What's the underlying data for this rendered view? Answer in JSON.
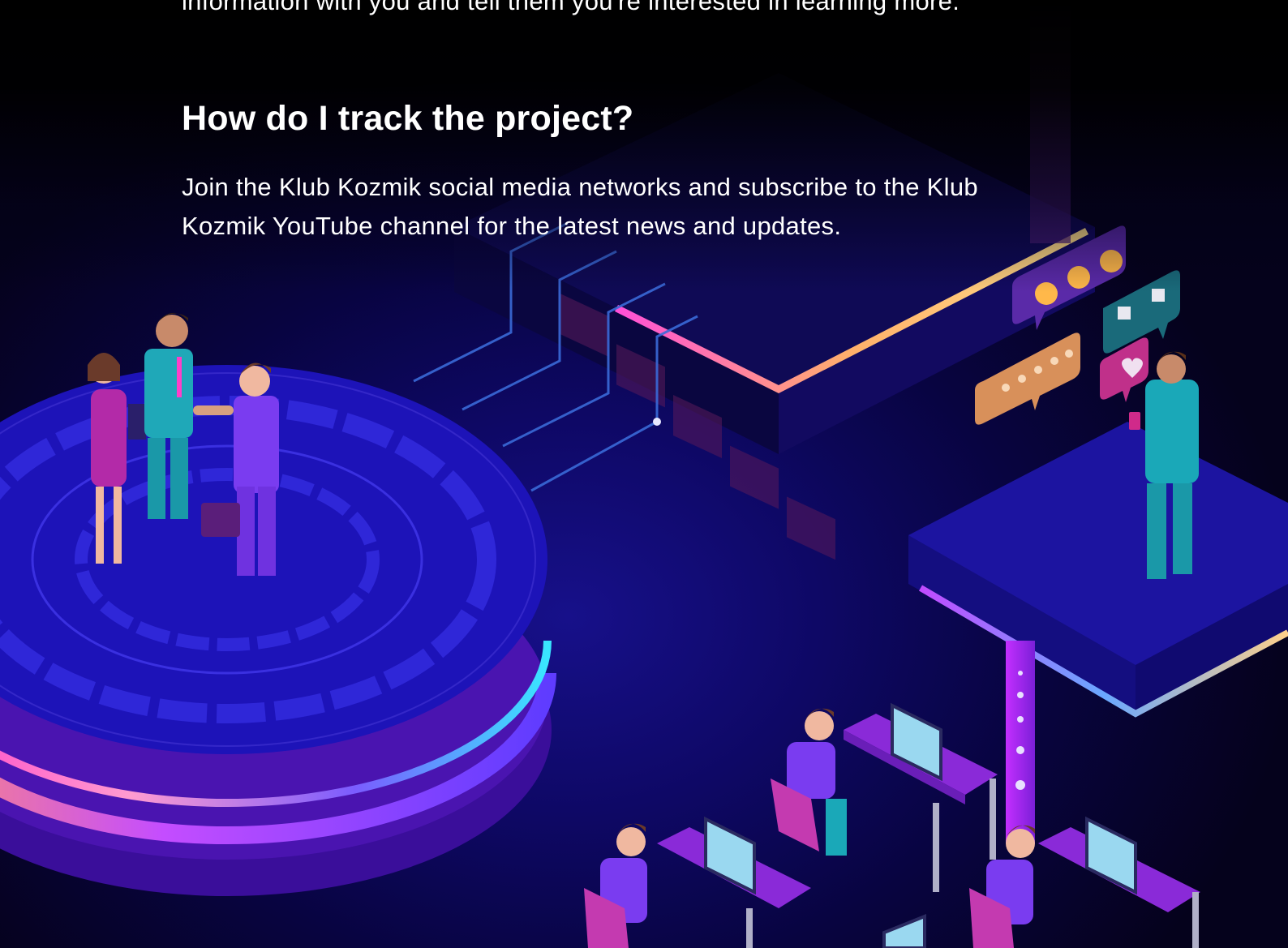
{
  "section": {
    "intro_tail": "information with you and tell them you're interested in learning more.",
    "heading": "How do I track the project?",
    "body": "Join the Klub Kozmik social media networks and subscribe to the Klub Kozmik YouTube channel for the latest news and updates."
  },
  "illustration": {
    "icons": [
      "handshake-scene",
      "circular-platform",
      "circuit-lines",
      "feedback-bubbles",
      "thumbs-up-down-icon",
      "heart-icon",
      "star-rating-icon",
      "emoji-faces-icon",
      "office-desks-scene",
      "laptop-icon"
    ],
    "colors": {
      "background": "#0e0865",
      "accent_magenta": "#ff3ec8",
      "accent_cyan": "#39e6ff",
      "accent_orange": "#ffb06a",
      "text": "#ffffff"
    }
  }
}
